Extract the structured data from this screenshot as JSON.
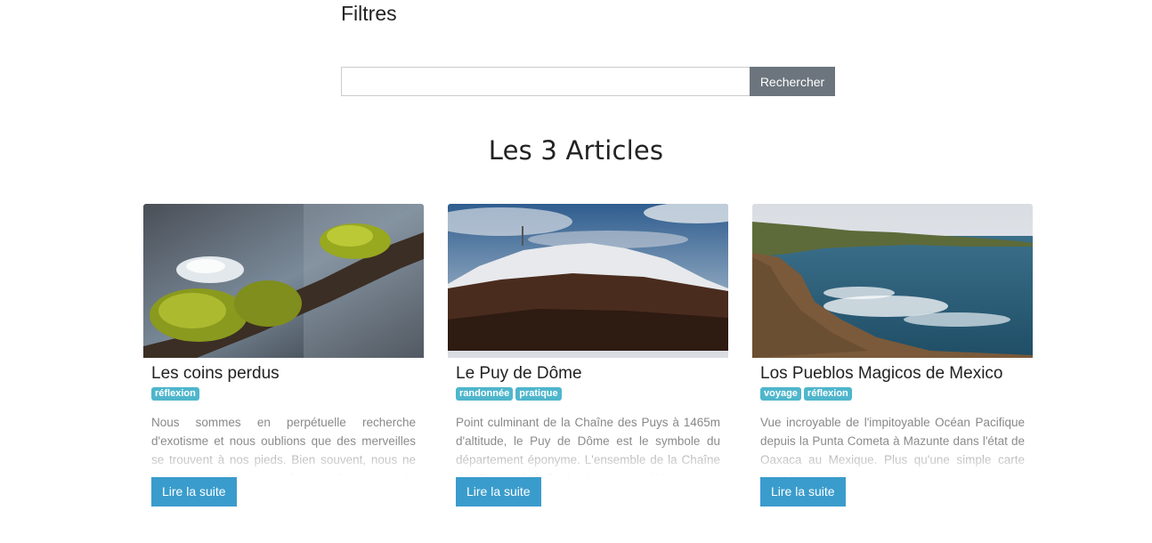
{
  "filters": {
    "title": "Filtres"
  },
  "search": {
    "value": "",
    "placeholder": "",
    "button_label": "Rechercher"
  },
  "articles_section": {
    "title": "Les 3 Articles"
  },
  "articles": [
    {
      "title": "Les coins perdus",
      "tags": [
        "réflexion"
      ],
      "excerpt": "Nous sommes en perpétuelle recherche d'exotisme et nous oublions que des merveilles se trouvent à nos pieds. Bien souvent, nous ne prenons pas le temps de regarder autour de nous...",
      "button_label": "Lire la suite"
    },
    {
      "title": "Le Puy de Dôme",
      "tags": [
        "randonnée",
        "pratique"
      ],
      "excerpt": "Point culminant de la Chaîne des Puys à 1465m d'altitude, le Puy de Dôme est le symbole du département éponyme. L'ensemble de la Chaîne des Puys et la faille de Limagne ont été...",
      "button_label": "Lire la suite"
    },
    {
      "title": "Los Pueblos Magicos de Mexico",
      "tags": [
        "voyage",
        "réflexion"
      ],
      "excerpt": "Vue incroyable de l'impitoyable Océan Pacifique depuis la Punta Cometa à Mazunte dans l'état de Oaxaca au Mexique. Plus qu'une simple carte postale, cette côte...",
      "button_label": "Lire la suite"
    }
  ]
}
